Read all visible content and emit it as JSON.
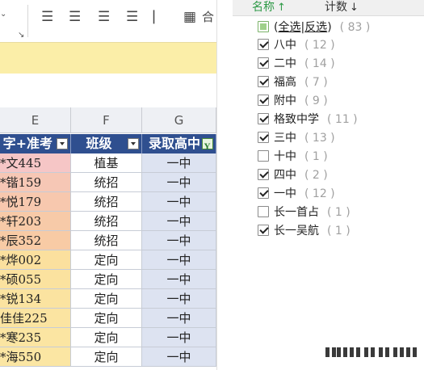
{
  "ribbon": {
    "icons": [
      "align-left-icon",
      "align-center-icon",
      "align-right-icon",
      "justify-icon",
      "wrap-text-icon",
      "merge-cells-icon"
    ],
    "merge_label": "合"
  },
  "columns": [
    {
      "letter": "E",
      "header": "字+准考"
    },
    {
      "letter": "F",
      "header": "班级"
    },
    {
      "letter": "G",
      "header": "录取高中"
    }
  ],
  "rows": [
    {
      "e": "*文445",
      "f": "植基",
      "g": "一中",
      "e_color": "#f6c6c6"
    },
    {
      "e": "*锴159",
      "f": "统招",
      "g": "一中",
      "e_color": "#f6c7b5"
    },
    {
      "e": "*悦179",
      "f": "统招",
      "g": "一中",
      "e_color": "#f7c8ae"
    },
    {
      "e": "*轩203",
      "f": "统招",
      "g": "一中",
      "e_color": "#f7caa8"
    },
    {
      "e": "*辰352",
      "f": "统招",
      "g": "一中",
      "e_color": "#f8cba5"
    },
    {
      "e": "*烨002",
      "f": "定向",
      "g": "一中",
      "e_color": "#fbe09e"
    },
    {
      "e": "*硕055",
      "f": "定向",
      "g": "一中",
      "e_color": "#fbe29f"
    },
    {
      "e": "*锐134",
      "f": "定向",
      "g": "一中",
      "e_color": "#fbe3a0"
    },
    {
      "e": "佳佳225",
      "f": "定向",
      "g": "一中",
      "e_color": "#fbe4a1"
    },
    {
      "e": "*寒235",
      "f": "定向",
      "g": "一中",
      "e_color": "#fbe5a2"
    },
    {
      "e": "*海550",
      "f": "定向",
      "g": "一中",
      "e_color": "#fbe6a3"
    }
  ],
  "panel": {
    "sort_name": "名称",
    "sort_name_arrow": "↑",
    "sort_count": "计数",
    "sort_count_arrow": "↓",
    "select_all": "全选",
    "separator": "|",
    "invert": "反选",
    "total": "( 83 )",
    "options": [
      {
        "label": "八中",
        "count": "( 12 )",
        "checked": true
      },
      {
        "label": "二中",
        "count": "( 14 )",
        "checked": true
      },
      {
        "label": "福高",
        "count": "( 7 )",
        "checked": true
      },
      {
        "label": "附中",
        "count": "( 9 )",
        "checked": true
      },
      {
        "label": "格致中学",
        "count": "( 11 )",
        "checked": true
      },
      {
        "label": "三中",
        "count": "( 13 )",
        "checked": true
      },
      {
        "label": "十中",
        "count": "( 1 )",
        "checked": false
      },
      {
        "label": "四中",
        "count": "( 2 )",
        "checked": true
      },
      {
        "label": "一中",
        "count": "( 12 )",
        "checked": true
      },
      {
        "label": "长一首占",
        "count": "( 1 )",
        "checked": false
      },
      {
        "label": "长一吴航",
        "count": "( 1 )",
        "checked": true
      }
    ]
  },
  "colors": {
    "header_bg": "#2f4f8f",
    "col_g_bg": "#dde3f1",
    "banner_bg": "#fbeea8",
    "sort_active": "#2e9a47"
  }
}
